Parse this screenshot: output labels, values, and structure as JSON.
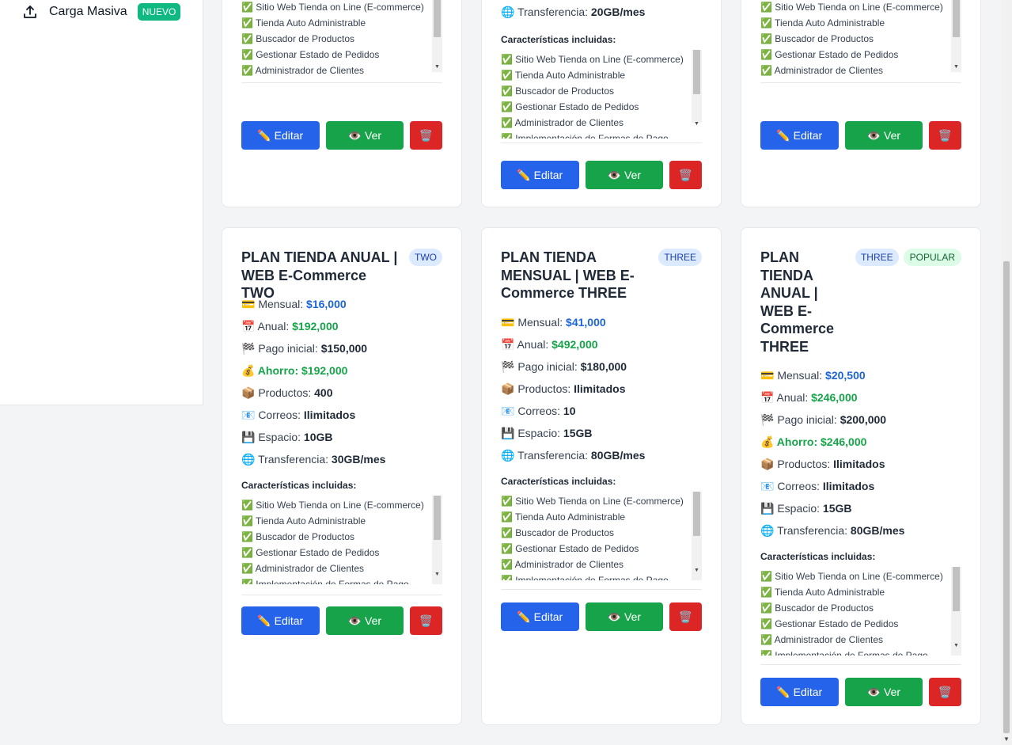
{
  "sidebar": {
    "item_label": "Carga Masiva",
    "item_badge": "NUEVO",
    "item_icon": "upload-icon"
  },
  "labels": {
    "features_title": "Características incluidas:",
    "edit": "✏️ Editar",
    "view": "👁️ Ver",
    "delete": "🗑️"
  },
  "features": [
    "✅ Sitio Web Tienda on Line (E-commerce)",
    "✅ Tienda Auto Administrable",
    "✅ Buscador de Productos",
    "✅ Gestionar Estado de Pedidos",
    "✅ Administrador de Clientes",
    "✅ Implementación de Formas de Pago"
  ],
  "top_cards": [
    {
      "transfer_label": "",
      "transfer_value": ""
    },
    {
      "transfer_label": "🌐 Transferencia:",
      "transfer_value": "20GB/mes"
    },
    {
      "transfer_label": "",
      "transfer_value": ""
    }
  ],
  "cards": [
    {
      "title": "PLAN TIENDA ANUAL | WEB E-Commerce TWO",
      "badge": "TWO",
      "popular": "",
      "rows": [
        {
          "label": "💳 Mensual: ",
          "value": "$16,000",
          "style": "blue"
        },
        {
          "label": "📅 Anual: ",
          "value": "$192,000",
          "style": "green"
        },
        {
          "label": "🏁 Pago inicial: ",
          "value": "$150,000",
          "style": ""
        },
        {
          "label": "💰 Ahorro: ",
          "value": "$192,000",
          "style": "save"
        },
        {
          "label": "📦 Productos: ",
          "value": "400",
          "style": ""
        },
        {
          "label": "📧 Correos: ",
          "value": "Ilimitados",
          "style": ""
        },
        {
          "label": "💾 Espacio: ",
          "value": "10GB",
          "style": ""
        },
        {
          "label": "🌐 Transferencia: ",
          "value": "30GB/mes",
          "style": ""
        }
      ]
    },
    {
      "title": "PLAN TIENDA MENSUAL | WEB E-Commerce THREE",
      "badge": "THREE",
      "popular": "",
      "rows": [
        {
          "label": "💳 Mensual: ",
          "value": "$41,000",
          "style": "blue"
        },
        {
          "label": "📅 Anual: ",
          "value": "$492,000",
          "style": "green"
        },
        {
          "label": "🏁 Pago inicial: ",
          "value": "$180,000",
          "style": ""
        },
        {
          "label": "📦 Productos: ",
          "value": "Ilimitados",
          "style": ""
        },
        {
          "label": "📧 Correos: ",
          "value": "10",
          "style": ""
        },
        {
          "label": "💾 Espacio: ",
          "value": "15GB",
          "style": ""
        },
        {
          "label": "🌐 Transferencia: ",
          "value": "80GB/mes",
          "style": ""
        }
      ]
    },
    {
      "title": "PLAN TIENDA ANUAL | WEB E-Commerce THREE",
      "badge": "THREE",
      "popular": "POPULAR",
      "rows": [
        {
          "label": "💳 Mensual: ",
          "value": "$20,500",
          "style": "blue"
        },
        {
          "label": "📅 Anual: ",
          "value": "$246,000",
          "style": "green"
        },
        {
          "label": "🏁 Pago inicial: ",
          "value": "$200,000",
          "style": ""
        },
        {
          "label": "💰 Ahorro: ",
          "value": "$246,000",
          "style": "save"
        },
        {
          "label": "📦 Productos: ",
          "value": "Ilimitados",
          "style": ""
        },
        {
          "label": "📧 Correos: ",
          "value": "Ilimitados",
          "style": ""
        },
        {
          "label": "💾 Espacio: ",
          "value": "15GB",
          "style": ""
        },
        {
          "label": "🌐 Transferencia: ",
          "value": "80GB/mes",
          "style": ""
        }
      ]
    }
  ]
}
